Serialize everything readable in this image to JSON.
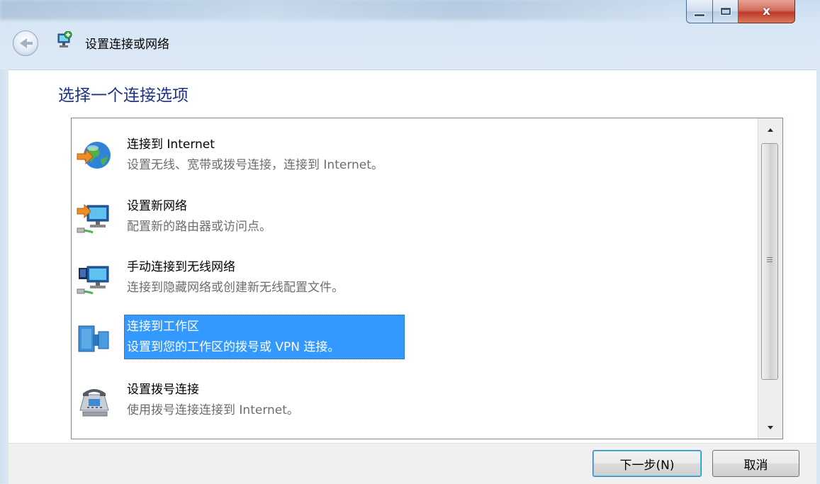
{
  "window": {
    "title": "设置连接或网络",
    "controls": {
      "minimize": "minimize",
      "maximize": "maximize",
      "close": "x"
    }
  },
  "page": {
    "heading": "选择一个连接选项"
  },
  "options": [
    {
      "title": "连接到 Internet",
      "description": "设置无线、宽带或拨号连接，连接到 Internet。",
      "icon": "globe-icon",
      "selected": false
    },
    {
      "title": "设置新网络",
      "description": "配置新的路由器或访问点。",
      "icon": "network-computer-icon",
      "selected": false
    },
    {
      "title": "手动连接到无线网络",
      "description": "连接到隐藏网络或创建新无线配置文件。",
      "icon": "wireless-computer-icon",
      "selected": false
    },
    {
      "title": "连接到工作区",
      "description": "设置到您的工作区的拨号或 VPN 连接。",
      "icon": "workplace-icon",
      "selected": true
    },
    {
      "title": "设置拨号连接",
      "description": "使用拨号连接连接到 Internet。",
      "icon": "phone-modem-icon",
      "selected": false
    }
  ],
  "buttons": {
    "next": "下一步(N)",
    "cancel": "取消"
  },
  "colors": {
    "heading": "#1e3287",
    "selection": "#3399ff",
    "close_button": "#c0392b"
  }
}
